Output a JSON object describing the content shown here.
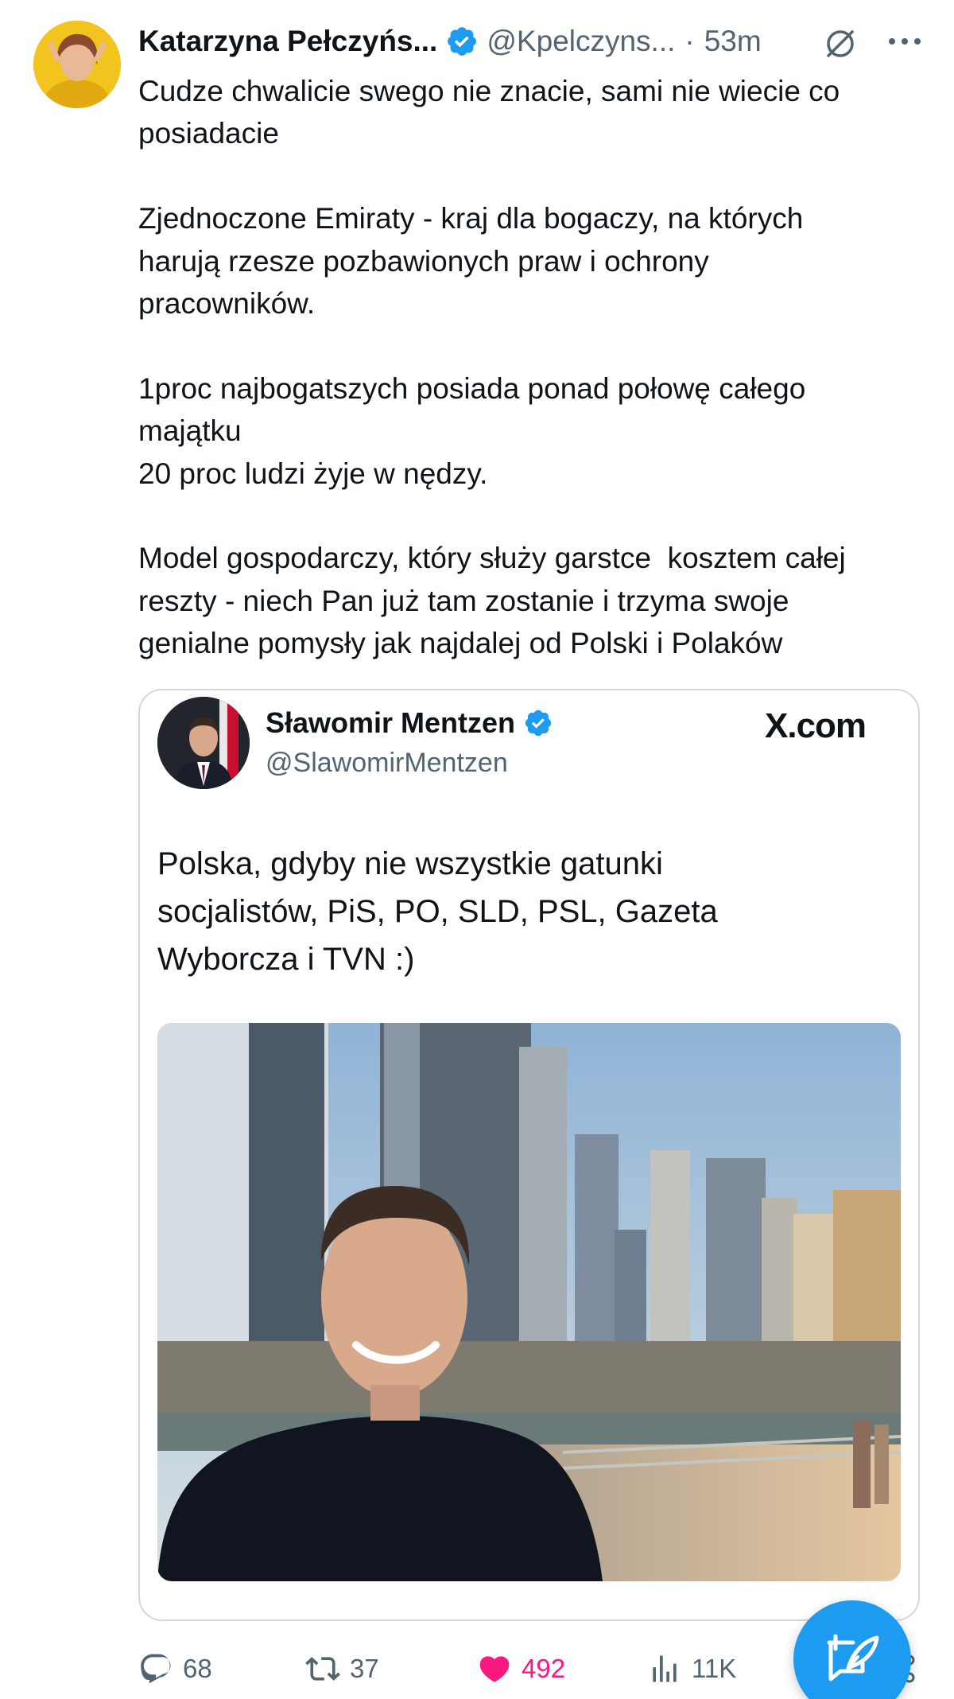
{
  "author": {
    "name": "Katarzyna Pełczyńs...",
    "handle": "@Kpelczyns...",
    "separator": "·",
    "time": "53m",
    "verified": true,
    "avatar_icon": "profile-photo"
  },
  "tweet": {
    "text": "Cudze chwalicie swego nie znacie, sami nie wiecie co\nposiadacie\n\nZjednoczone Emiraty - kraj dla bogaczy, na których\nharują rzesze pozbawionych praw i ochrony\npracowników.\n\n1proc najbogatszych posiada ponad połowę całego\nmajątku\n20 proc ludzi żyje w nędzy.\n\nModel gospodarczy, który służy garstce  kosztem całej\nreszty - niech Pan już tam zostanie i trzyma swoje\ngenialne pomysły jak najdalej od Polski i Polaków"
  },
  "quoted_card": {
    "name": "Sławomir Mentzen",
    "handle": "@SlawomirMentzen",
    "source": "X.com",
    "verified": true,
    "text": "Polska, gdyby nie wszystkie gatunki\nsocjalistów, PiS, PO, SLD, PSL, Gazeta\nWyborcza i TVN :)"
  },
  "actions": {
    "replies": "68",
    "reposts": "37",
    "likes": "492",
    "views": "11K"
  },
  "colors": {
    "verified_blue": "#1d9bf0",
    "like_pink": "#f91880",
    "secondary_text": "#536471",
    "border": "#cfd9de"
  },
  "icons": [
    "verified-badge-icon",
    "grok-icon",
    "more-icon",
    "reply-icon",
    "repost-icon",
    "like-icon",
    "views-icon",
    "share-icon",
    "compose-icon"
  ]
}
